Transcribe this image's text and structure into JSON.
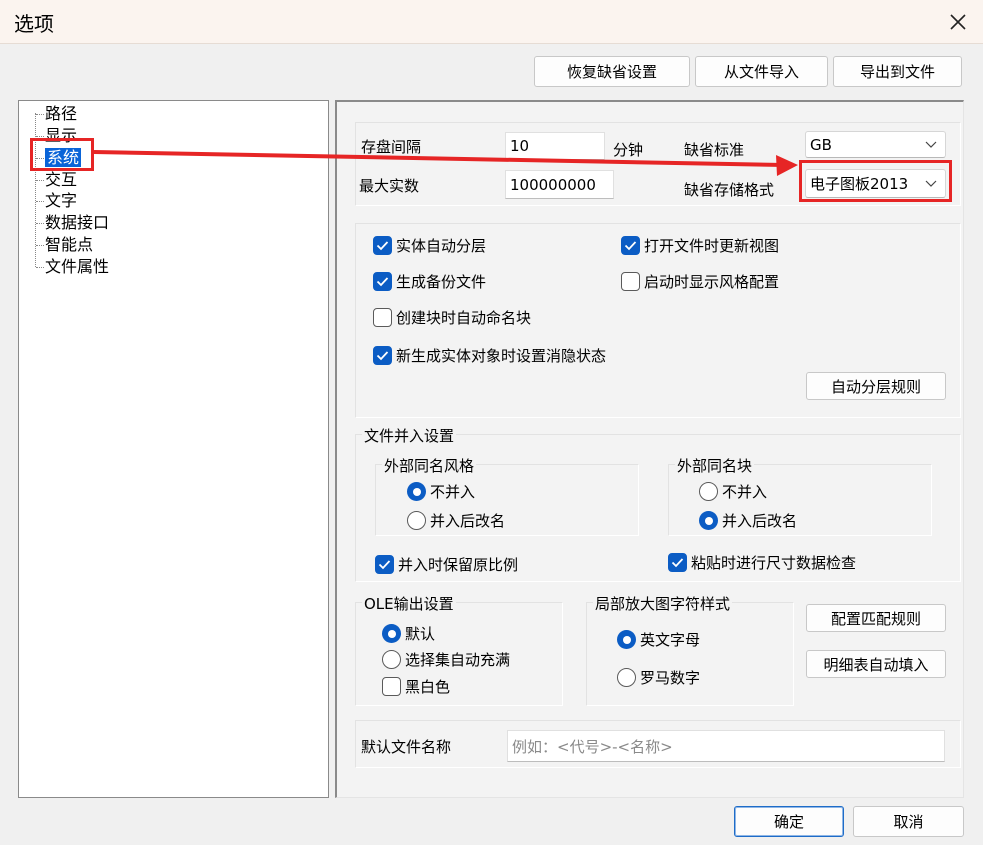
{
  "window": {
    "title": "选项"
  },
  "toolbar": {
    "restore_label": "恢复缺省设置",
    "import_label": "从文件导入",
    "export_label": "导出到文件"
  },
  "tree": {
    "items": [
      {
        "label": "路径"
      },
      {
        "label": "显示"
      },
      {
        "label": "系统"
      },
      {
        "label": "交互"
      },
      {
        "label": "文字"
      },
      {
        "label": "数据接口"
      },
      {
        "label": "智能点"
      },
      {
        "label": "文件属性"
      }
    ]
  },
  "system": {
    "save_interval_label": "存盘间隔",
    "save_interval_value": "10",
    "save_interval_unit": "分钟",
    "max_entities_label": "最大实数",
    "max_entities_value": "100000000",
    "default_standard_label": "缺省标准",
    "default_standard_value": "GB",
    "default_format_label": "缺省存储格式",
    "default_format_value": "电子图板2013"
  },
  "options": {
    "auto_layer": {
      "label": "实体自动分层",
      "checked": true
    },
    "refresh_view": {
      "label": "打开文件时更新视图",
      "checked": true
    },
    "backup": {
      "label": "生成备份文件",
      "checked": true
    },
    "style_config": {
      "label": "启动时显示风格配置",
      "checked": false
    },
    "auto_block_name": {
      "label": "创建块时自动命名块",
      "checked": false
    },
    "hide_state": {
      "label": "新生成实体对象时设置消隐状态",
      "checked": true
    },
    "layer_rule_label": "自动分层规则"
  },
  "merge": {
    "title": "文件并入设置",
    "style_group": {
      "title": "外部同名风格",
      "opt1": "不并入",
      "opt2": "并入后改名",
      "selected": 1
    },
    "block_group": {
      "title": "外部同名块",
      "opt1": "不并入",
      "opt2": "并入后改名",
      "selected": 2
    },
    "keep_scale": {
      "label": "并入时保留原比例",
      "checked": true
    },
    "paste_check": {
      "label": "粘贴时进行尺寸数据检查",
      "checked": true
    }
  },
  "ole": {
    "title": "OLE输出设置",
    "opt1": "默认",
    "opt2": "选择集自动充满",
    "selected": 1,
    "bw": {
      "label": "黑白色",
      "checked": false
    }
  },
  "zoom": {
    "title": "局部放大图字符样式",
    "opt1": "英文字母",
    "opt2": "罗马数字",
    "selected": 1
  },
  "side_buttons": {
    "match_rule_label": "配置匹配规则",
    "table_fill_label": "明细表自动填入"
  },
  "filename": {
    "label": "默认文件名称",
    "placeholder": "例如：<代号>-<名称>"
  },
  "footer": {
    "ok_label": "确定",
    "cancel_label": "取消"
  },
  "colors": {
    "accent": "#0b5cc4",
    "annotation": "#e62525",
    "selection": "#0a64d8"
  }
}
